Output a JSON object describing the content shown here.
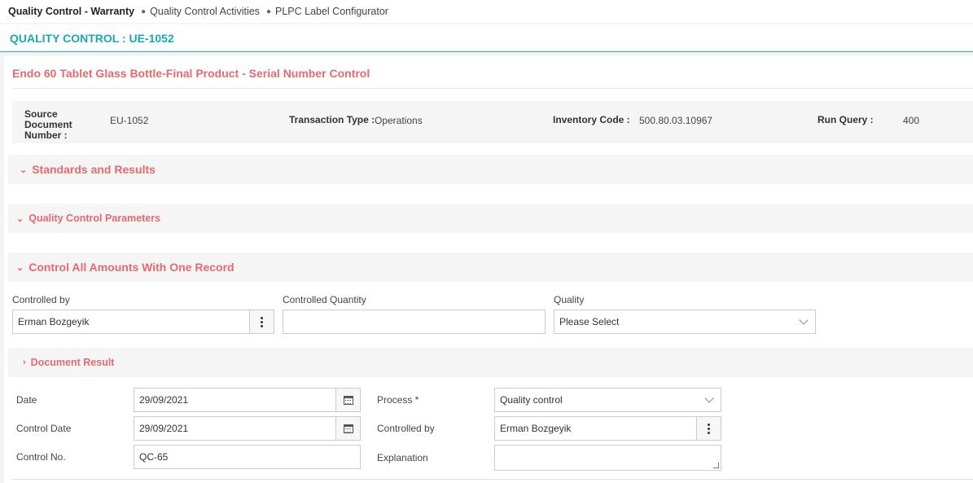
{
  "breadcrumb": {
    "first": "Quality Control - Warranty",
    "items": [
      "Quality Control Activities",
      "PLPC Label Configurator"
    ]
  },
  "page_title": "QUALITY CONTROL : UE-1052",
  "card_title": "Endo 60 Tablet Glass Bottle-Final Product - Serial Number Control",
  "info": {
    "source_doc_label": "Source Document Number :",
    "source_doc_value": "EU-1052",
    "transaction_type_label": "Transaction Type :",
    "transaction_type_value": "Operations",
    "inventory_code_label": "Inventory Code :",
    "inventory_code_value": "500.80.03.10967",
    "run_query_label": "Run Query :",
    "run_query_value": "400"
  },
  "sections": {
    "standards": "Standards and Results",
    "qc_params": "Quality Control Parameters",
    "control_all": "Control All Amounts With One Record",
    "document_result": "Document Result"
  },
  "control_all": {
    "controlled_by_label": "Controlled by",
    "controlled_by_value": "Erman Bozgeyik",
    "controlled_qty_label": "Controlled Quantity",
    "controlled_qty_value": "",
    "quality_label": "Quality",
    "quality_value": "Please Select"
  },
  "document_result": {
    "date_label": "Date",
    "date_value": "29/09/2021",
    "control_date_label": "Control Date",
    "control_date_value": "29/09/2021",
    "control_no_label": "Control No.",
    "control_no_value": "QC-65",
    "process_label": "Process *",
    "process_value": "Quality control",
    "controlled_by_label": "Controlled by",
    "controlled_by_value": "Erman Bozgeyik",
    "explanation_label": "Explanation",
    "explanation_value": ""
  },
  "colors": {
    "accent_teal": "#17a9b4",
    "section_red": "#e8696d"
  }
}
